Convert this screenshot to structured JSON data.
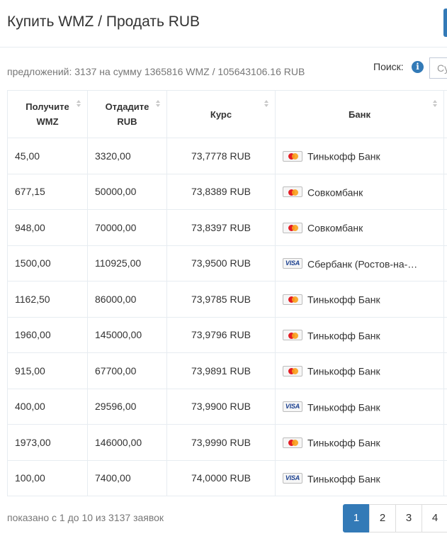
{
  "header": {
    "title": "Купить WMZ / Продать RUB"
  },
  "summary": "предложений: 3137 на сумму 1365816 WMZ / 105643106.16 RUB",
  "search": {
    "label": "Поиск:",
    "info_icon": "info-icon",
    "placeholder": "Су"
  },
  "table": {
    "columns": [
      "Получите WMZ",
      "Отдадите RUB",
      "Курс",
      "Банк"
    ],
    "rows": [
      {
        "receive": "45,00",
        "give": "3320,00",
        "rate": "73,7778 RUB",
        "card": "mastercard",
        "bank": "Тинькофф Банк"
      },
      {
        "receive": "677,15",
        "give": "50000,00",
        "rate": "73,8389 RUB",
        "card": "mastercard",
        "bank": "Совкомбанк"
      },
      {
        "receive": "948,00",
        "give": "70000,00",
        "rate": "73,8397 RUB",
        "card": "mastercard",
        "bank": "Совкомбанк"
      },
      {
        "receive": "1500,00",
        "give": "110925,00",
        "rate": "73,9500 RUB",
        "card": "visa",
        "bank": "Сбербанк (Ростов-на-…"
      },
      {
        "receive": "1162,50",
        "give": "86000,00",
        "rate": "73,9785 RUB",
        "card": "mastercard",
        "bank": "Тинькофф Банк"
      },
      {
        "receive": "1960,00",
        "give": "145000,00",
        "rate": "73,9796 RUB",
        "card": "mastercard",
        "bank": "Тинькофф Банк"
      },
      {
        "receive": "915,00",
        "give": "67700,00",
        "rate": "73,9891 RUB",
        "card": "mastercard",
        "bank": "Тинькофф Банк"
      },
      {
        "receive": "400,00",
        "give": "29596,00",
        "rate": "73,9900 RUB",
        "card": "visa",
        "bank": "Тинькофф Банк"
      },
      {
        "receive": "1973,00",
        "give": "146000,00",
        "rate": "73,9990 RUB",
        "card": "mastercard",
        "bank": "Тинькофф Банк"
      },
      {
        "receive": "100,00",
        "give": "7400,00",
        "rate": "74,0000 RUB",
        "card": "visa",
        "bank": "Тинькофф Банк"
      }
    ]
  },
  "footer": {
    "info": "показано с 1 до 10 из 3137 заявок"
  },
  "pagination": {
    "pages": [
      "1",
      "2",
      "3",
      "4"
    ],
    "active": "1"
  },
  "colors": {
    "accent": "#337ab7",
    "border": "#e7ecf1"
  }
}
